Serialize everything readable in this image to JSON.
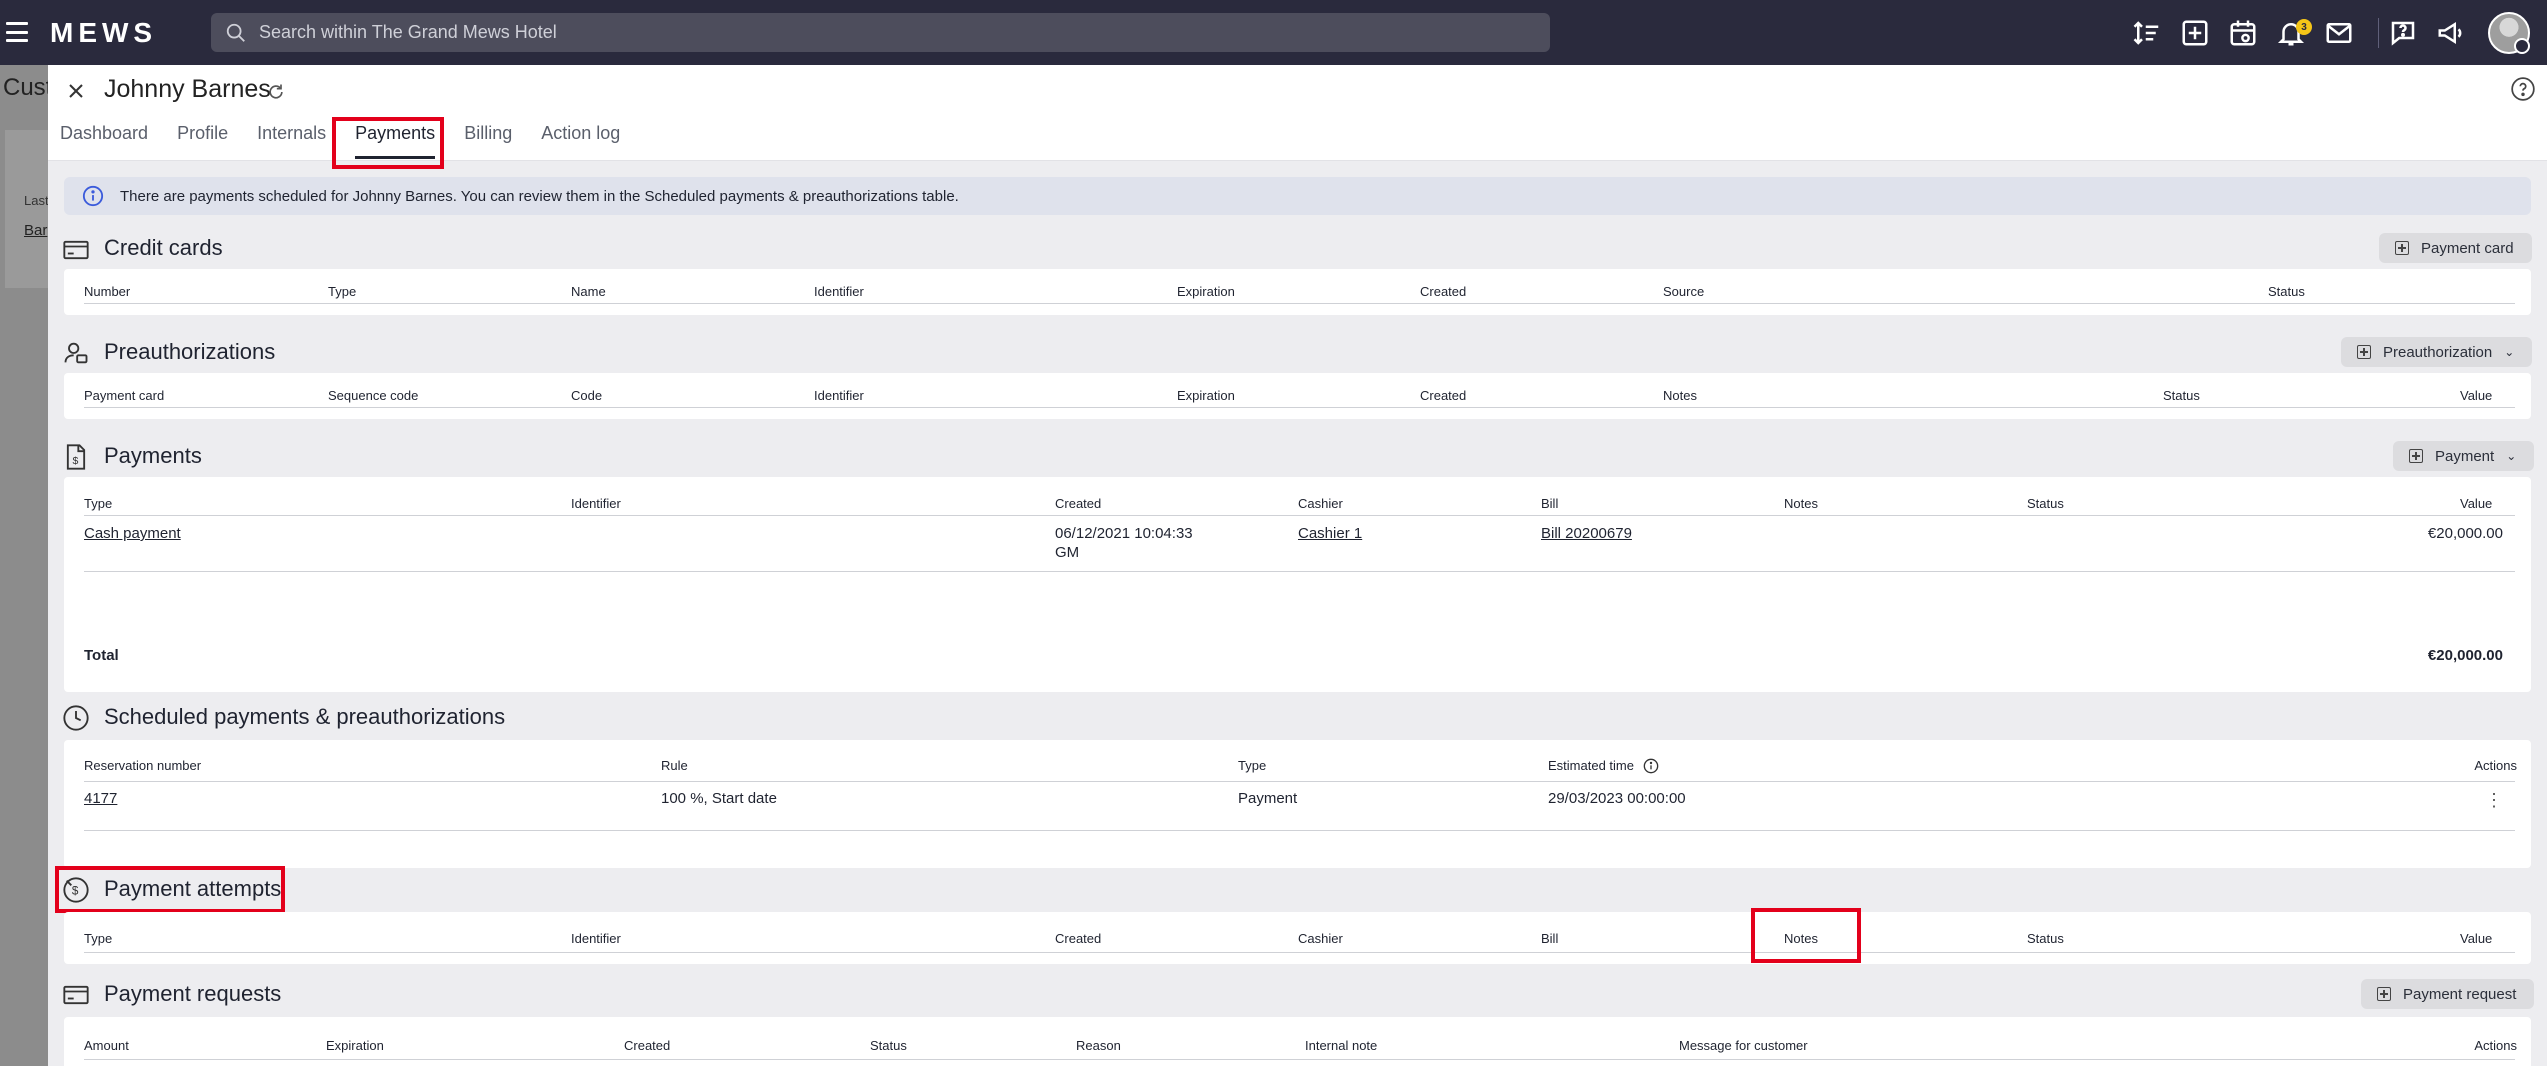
{
  "topbar": {
    "logo": "MEWS",
    "search_placeholder": "Search within The Grand Mews Hotel",
    "notification_count": "3",
    "icons": [
      "sort-icon",
      "add-box-icon",
      "calendar-icon",
      "bell-icon",
      "mail-icon",
      "help-chat-icon",
      "megaphone-icon"
    ]
  },
  "background": {
    "title": "Cust",
    "label": "Last",
    "link": "Bar"
  },
  "panel": {
    "customer_name": "Johnny Barnes",
    "tabs": [
      "Dashboard",
      "Profile",
      "Internals",
      "Payments",
      "Billing",
      "Action log"
    ],
    "active_tab": "Payments",
    "info_text": "There are payments scheduled for Johnny Barnes. You can review them in the Scheduled payments & preauthorizations table."
  },
  "credit_cards": {
    "title": "Credit cards",
    "button": "Payment card",
    "columns": [
      "Number",
      "Type",
      "Name",
      "Identifier",
      "Expiration",
      "Created",
      "Source",
      "Status"
    ]
  },
  "preauthorizations": {
    "title": "Preauthorizations",
    "button": "Preauthorization",
    "columns": [
      "Payment card",
      "Sequence code",
      "Code",
      "Identifier",
      "Expiration",
      "Created",
      "Notes",
      "Status",
      "Value"
    ]
  },
  "payments": {
    "title": "Payments",
    "button": "Payment",
    "columns": [
      "Type",
      "Identifier",
      "Created",
      "Cashier",
      "Bill",
      "Notes",
      "Status",
      "Value"
    ],
    "rows": [
      {
        "type": "Cash payment",
        "created_line1": "06/12/2021 10:04:33",
        "created_line2": "GM",
        "cashier": "Cashier 1",
        "bill": "Bill 20200679",
        "value": "€20,000.00"
      }
    ],
    "total_label": "Total",
    "total_value": "€20,000.00"
  },
  "scheduled": {
    "title": "Scheduled payments & preauthorizations",
    "columns": [
      "Reservation number",
      "Rule",
      "Type",
      "Estimated time",
      "Actions"
    ],
    "rows": [
      {
        "reservation": "4177",
        "rule": "100 %, Start date",
        "type": "Payment",
        "estimated_time": "29/03/2023 00:00:00"
      }
    ]
  },
  "payment_attempts": {
    "title": "Payment attempts",
    "columns": [
      "Type",
      "Identifier",
      "Created",
      "Cashier",
      "Bill",
      "Notes",
      "Status",
      "Value"
    ]
  },
  "payment_requests": {
    "title": "Payment requests",
    "button": "Payment request",
    "columns": [
      "Amount",
      "Expiration",
      "Created",
      "Status",
      "Reason",
      "Internal note",
      "Message for customer",
      "Actions"
    ]
  }
}
